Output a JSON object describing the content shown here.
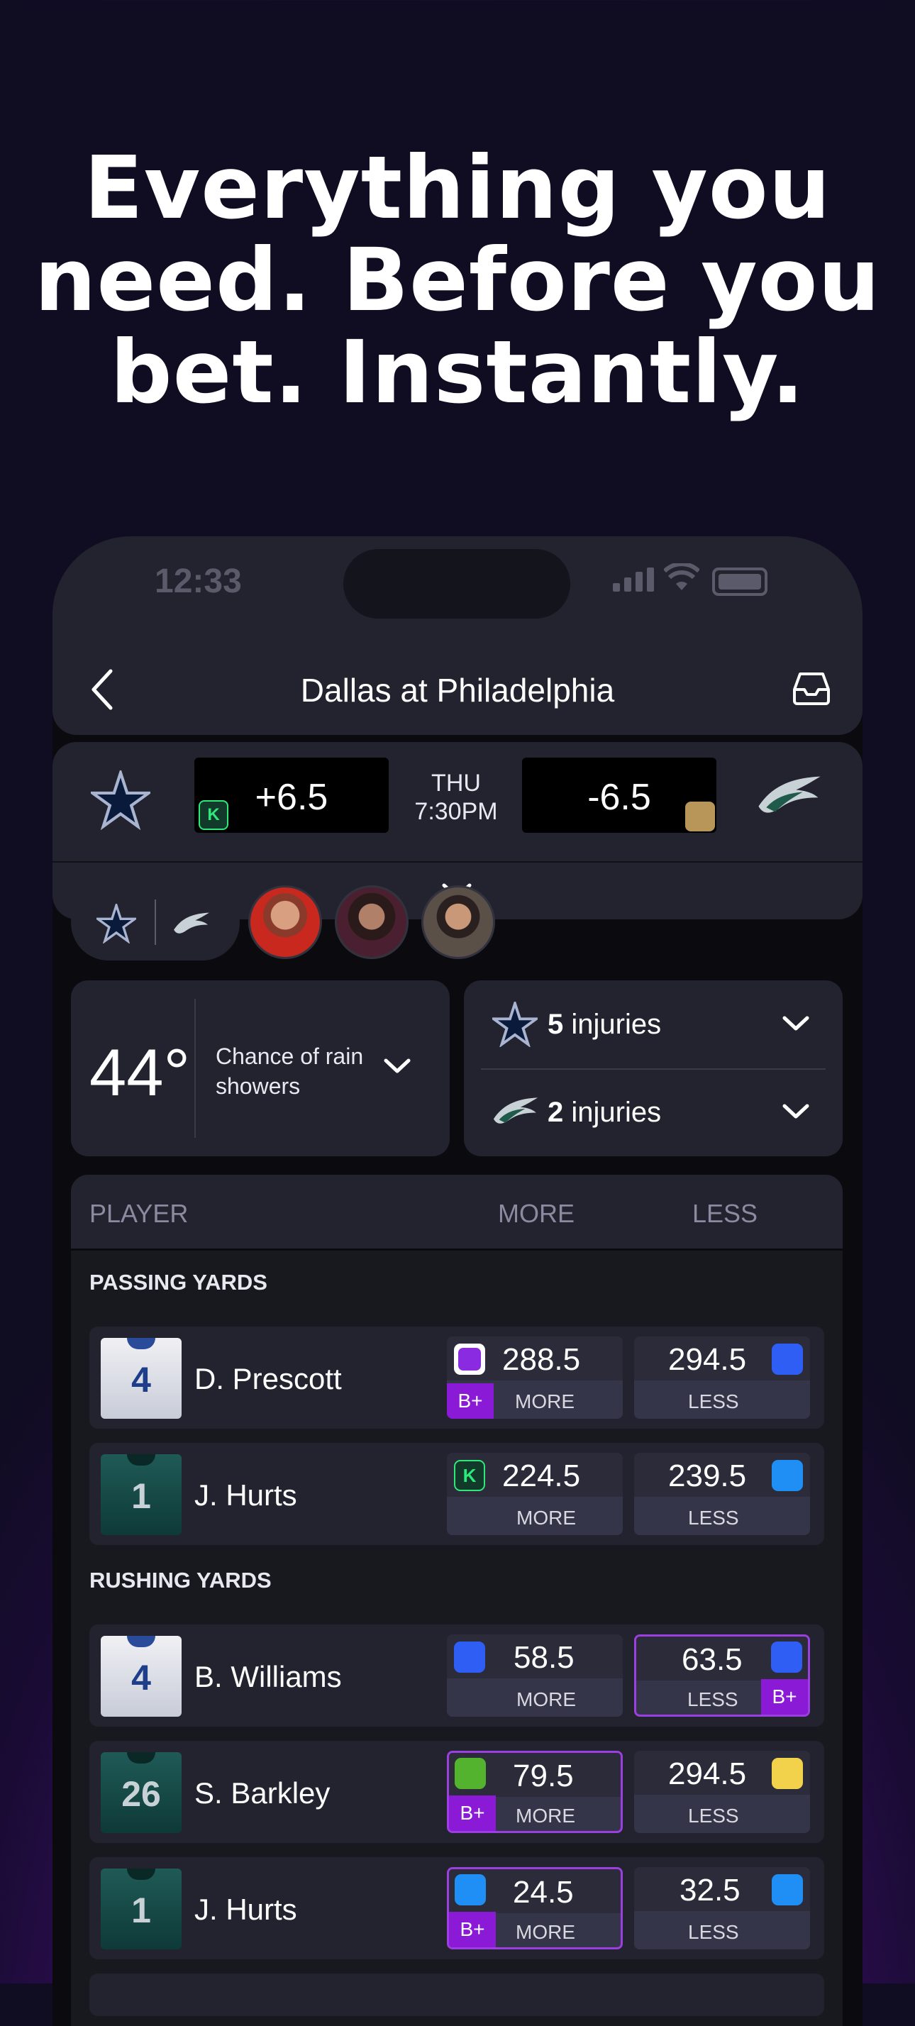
{
  "headline": [
    "Everything you",
    "need. Before you",
    "bet. Instantly."
  ],
  "status": {
    "time": "12:33"
  },
  "nav": {
    "title": "Dallas at Philadelphia"
  },
  "odds": {
    "away_spread": "+6.5",
    "home_spread": "-6.5",
    "day": "THU",
    "time": "7:30PM",
    "away_book": "K"
  },
  "weather": {
    "temp": "44°",
    "desc_line1": "Chance of rain",
    "desc_line2": "showers"
  },
  "injuries": [
    {
      "count": "5",
      "label": "injuries"
    },
    {
      "count": "2",
      "label": "injuries"
    }
  ],
  "table": {
    "headers": {
      "player": "PLAYER",
      "more": "MORE",
      "less": "LESS"
    },
    "sections": [
      {
        "title": "PASSING YARDS",
        "rows": [
          {
            "number": "4",
            "name": "D. Prescott",
            "more": "288.5",
            "more_label": "MORE",
            "more_badge": "B+",
            "less": "294.5",
            "less_label": "LESS"
          },
          {
            "number": "1",
            "name": "J. Hurts",
            "more": "224.5",
            "more_label": "MORE",
            "less": "239.5",
            "less_label": "LESS"
          }
        ]
      },
      {
        "title": "RUSHING YARDS",
        "rows": [
          {
            "number": "4",
            "name": "B. Williams",
            "more": "58.5",
            "more_label": "MORE",
            "less": "63.5",
            "less_label": "LESS",
            "less_badge": "B+"
          },
          {
            "number": "26",
            "name": "S. Barkley",
            "more": "79.5",
            "more_label": "MORE",
            "more_badge": "B+",
            "less": "294.5",
            "less_label": "LESS"
          },
          {
            "number": "1",
            "name": "J. Hurts",
            "more": "24.5",
            "more_label": "MORE",
            "more_badge": "B+",
            "less": "32.5",
            "less_label": "LESS"
          }
        ]
      }
    ]
  },
  "colors": {
    "accent": "#8a1ad6",
    "card": "#23232f",
    "background": "#100c22"
  }
}
